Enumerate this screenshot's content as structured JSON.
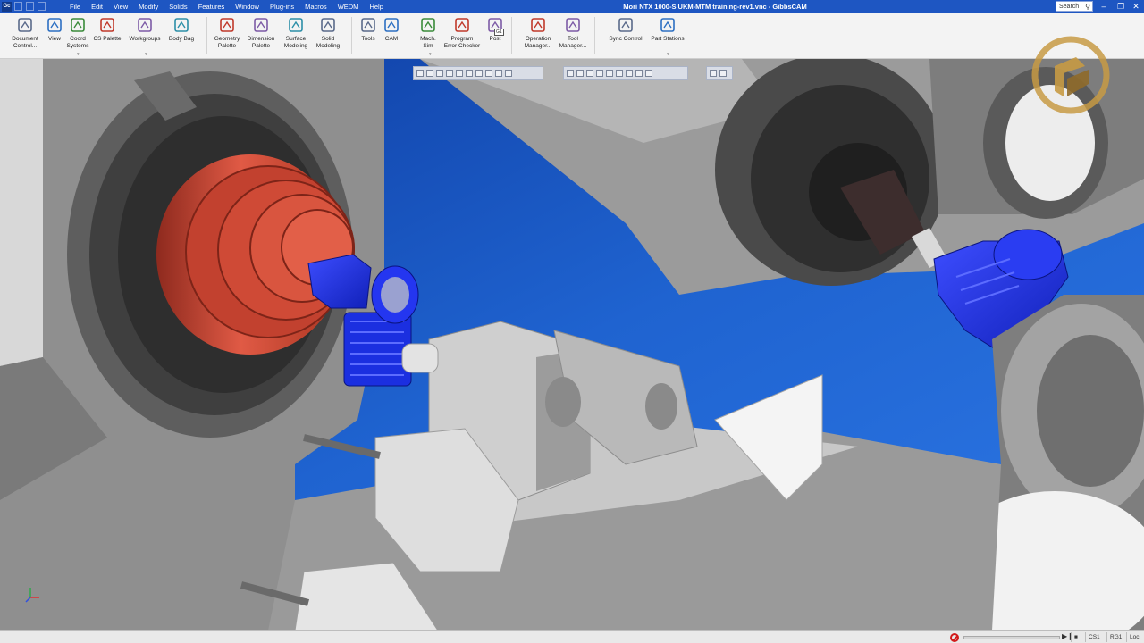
{
  "window": {
    "app_icon_label": "Gc",
    "title": "Mori NTX 1000-S UKM-MTM training-rev1.vnc - GibbsCAM",
    "search_placeholder": "Search"
  },
  "menu": [
    "File",
    "Edit",
    "View",
    "Modify",
    "Solids",
    "Features",
    "Window",
    "Plug-ins",
    "Macros",
    "WEDM",
    "Help"
  ],
  "ribbon": {
    "groups": [
      {
        "items": [
          {
            "line1": "Document",
            "line2": "Control...",
            "icon": "document-control-icon"
          },
          {
            "line1": "View",
            "line2": "",
            "icon": "view-icon"
          },
          {
            "line1": "Coord",
            "line2": "Systems",
            "icon": "coord-systems-icon"
          },
          {
            "line1": "CS Palette",
            "line2": "",
            "icon": "cs-palette-icon"
          },
          {
            "line1": "Workgroups",
            "line2": "",
            "icon": "workgroups-icon"
          },
          {
            "line1": "Body Bag",
            "line2": "",
            "icon": "body-bag-icon"
          }
        ]
      },
      {
        "items": [
          {
            "line1": "Geometry",
            "line2": "Palette",
            "icon": "geometry-palette-icon"
          },
          {
            "line1": "Dimension",
            "line2": "Palette",
            "icon": "dimension-palette-icon"
          },
          {
            "line1": "Surface",
            "line2": "Modeling",
            "icon": "surface-modeling-icon"
          },
          {
            "line1": "Solid",
            "line2": "Modeling",
            "icon": "solid-modeling-icon"
          }
        ]
      },
      {
        "items": [
          {
            "line1": "Tools",
            "line2": "",
            "icon": "tools-icon"
          },
          {
            "line1": "CAM",
            "line2": "",
            "icon": "cam-icon"
          },
          {
            "line1": "Mach.",
            "line2": "Sim",
            "icon": "machine-sim-icon"
          },
          {
            "line1": "Program",
            "line2": "Error Checker",
            "icon": "program-error-checker-icon"
          },
          {
            "line1": "Post",
            "line2": "",
            "icon": "post-icon"
          }
        ]
      },
      {
        "items": [
          {
            "line1": "Operation",
            "line2": "Manager...",
            "icon": "operation-manager-icon"
          },
          {
            "line1": "Tool",
            "line2": "Manager...",
            "icon": "tool-manager-icon"
          }
        ]
      },
      {
        "items": [
          {
            "line1": "Sync Control",
            "line2": "",
            "icon": "sync-control-icon"
          },
          {
            "line1": "Part Stations",
            "line2": "",
            "icon": "part-stations-icon"
          }
        ]
      }
    ],
    "post_badge": "G1"
  },
  "status": {
    "progress": 0.0,
    "cells": [
      "CS1",
      "RG1",
      "Loc"
    ]
  },
  "colors": {
    "title_bar": "#1e56c2",
    "viewport_blue": "#1f5fc8",
    "chuck_red": "#c8402e",
    "part_blue": "#1b2fe0",
    "machine_grey": "#a9a9a9",
    "logo_gold": "#c79a44"
  }
}
